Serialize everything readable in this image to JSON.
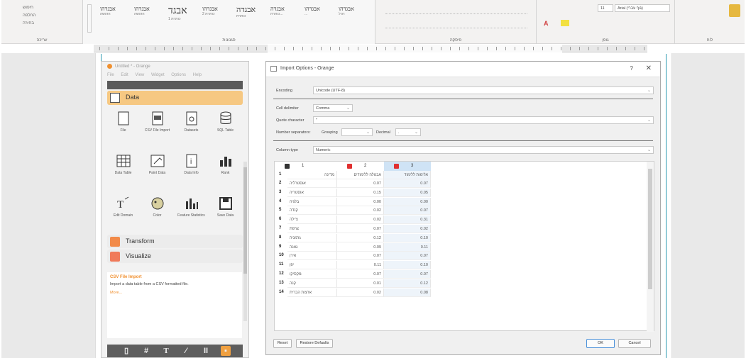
{
  "ribbon": {
    "clipboard_label": "לוח",
    "styles_label": "סגנונות",
    "paragraph_label": "פיסקה",
    "font_label": "גופן",
    "editing_label": "עריכה",
    "style_names": [
      "אבגדהו",
      "אבגדהו",
      "אבגד",
      "אבגדהו",
      "אבגדה",
      "אבגדה",
      "אבגדהו",
      "אבגדהו"
    ],
    "style_captions": [
      "הדגשה",
      "הדגשה",
      "כותרת 1",
      "כותרת 2",
      "כותרת",
      "כותרת...",
      "...",
      "רגיל"
    ],
    "font_box": "Arial (גוף עברי)",
    "size_box": "11",
    "editing_items": [
      "חיפוש",
      "החלפה",
      "בחירה"
    ]
  },
  "orange": {
    "title": "Untitled * - Orange",
    "menu": [
      "File",
      "Edit",
      "View",
      "Widget",
      "Options",
      "Help"
    ],
    "data_category": "Data",
    "widgets": [
      {
        "label": "File",
        "icon": "file-icon"
      },
      {
        "label": "CSV File Import",
        "icon": "csv-icon"
      },
      {
        "label": "Datasets",
        "icon": "datasets-icon"
      },
      {
        "label": "SQL Table",
        "icon": "sql-icon"
      },
      {
        "label": "Data Table",
        "icon": "data-table-icon"
      },
      {
        "label": "Paint Data",
        "icon": "paint-data-icon"
      },
      {
        "label": "Data Info",
        "icon": "data-info-icon"
      },
      {
        "label": "Rank",
        "icon": "rank-icon"
      },
      {
        "label": "Edit Domain",
        "icon": "edit-domain-icon"
      },
      {
        "label": "Color",
        "icon": "color-icon"
      },
      {
        "label": "Feature Statistics",
        "icon": "feature-statistics-icon"
      },
      {
        "label": "Save Data",
        "icon": "save-icon"
      }
    ],
    "transform_category": "Transform",
    "visualize_category": "Visualize",
    "help_title": "CSV File Import",
    "help_desc": "Import a data table from a CSV formatted file.",
    "help_more": "More...",
    "colors": {
      "orange": "#f09030",
      "data": "#f6c882",
      "transform": "#f28b4a",
      "visualize": "#f07a5a"
    }
  },
  "dialog": {
    "title": "Import Options - Orange",
    "help_glyph": "?",
    "close_glyph": "✕",
    "encoding_label": "Encoding",
    "encoding_value": "Unicode (UTF-8)",
    "delimiter_label": "Cell delimiter",
    "delimiter_value": "Comma",
    "quote_label": "Quote character",
    "quote_value": "\"",
    "number_sep_label": "Number separators:",
    "grouping_label": "Grouping",
    "decimal_label": "Decimal",
    "decimal_value": ".",
    "column_type_label": "Column type",
    "column_type_value": "Numeric",
    "columns": [
      {
        "num": "1",
        "chip": "#333333",
        "name": "מדינה"
      },
      {
        "num": "2",
        "chip": "#e03030",
        "name": "אבטלה ללימודים"
      },
      {
        "num": "3",
        "chip": "#e03030",
        "name": "אלימות ללימוד"
      }
    ],
    "rows": [
      {
        "n": "2",
        "a": "אוסטרליה",
        "b": "0.07",
        "c": "0.07"
      },
      {
        "n": "3",
        "a": "אוסטריה",
        "b": "0.15",
        "c": "0.05"
      },
      {
        "n": "4",
        "a": "בלגיה",
        "b": "0.00",
        "c": "0.00"
      },
      {
        "n": "5",
        "a": "קנדה",
        "b": "0.02",
        "c": "0.07"
      },
      {
        "n": "6",
        "a": "צ'ילה",
        "b": "0.02",
        "c": "0.31"
      },
      {
        "n": "7",
        "a": "צרפת",
        "b": "0.07",
        "c": "0.02"
      },
      {
        "n": "8",
        "a": "גרמניה",
        "b": "0.12",
        "c": "0.10"
      },
      {
        "n": "9",
        "a": "גאנה",
        "b": "0.09",
        "c": "0.11"
      },
      {
        "n": "10",
        "a": "אירן",
        "b": "0.07",
        "c": "0.07"
      },
      {
        "n": "11",
        "a": "יפן",
        "b": "0.11",
        "c": "0.10"
      },
      {
        "n": "12",
        "a": "מקסיקו",
        "b": "0.07",
        "c": "0.07"
      },
      {
        "n": "13",
        "a": "קנה",
        "b": "0.01",
        "c": "0.12"
      },
      {
        "n": "14",
        "a": "ארצות הברית",
        "b": "0.02",
        "c": "0.08"
      }
    ],
    "first_row_num": "1",
    "reset_label": "Reset",
    "restore_label": "Restore Defaults",
    "ok_label": "OK",
    "cancel_label": "Cancel"
  }
}
